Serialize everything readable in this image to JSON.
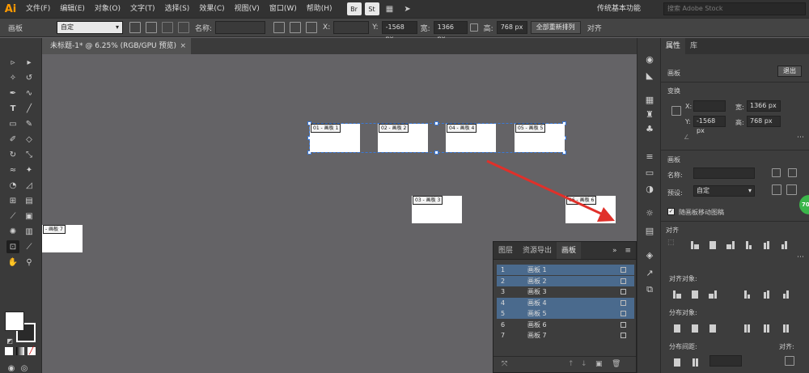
{
  "app": {
    "logo": "Ai",
    "workspace": "传统基本功能"
  },
  "menu": [
    "文件(F)",
    "编辑(E)",
    "对象(O)",
    "文字(T)",
    "选择(S)",
    "效果(C)",
    "视图(V)",
    "窗口(W)",
    "帮助(H)"
  ],
  "menu_badges": [
    "Br",
    "St"
  ],
  "search": {
    "placeholder": "搜索 Adobe Stock"
  },
  "control": {
    "panel_label": "画板",
    "preset": "自定",
    "name_label": "名称:",
    "x_label": "X:",
    "y_label": "Y:",
    "y_value": "-1568 px",
    "w_label": "宽:",
    "w_value": "1366 px",
    "h_label": "高:",
    "h_value": "768 px",
    "rearrange_button": "全部重新排列",
    "align_label": "对齐"
  },
  "doc_tab": {
    "title": "未标题-1* @ 6.25% (RGB/GPU 预览)",
    "close": "×"
  },
  "artboards": {
    "a1": "01 - 画板 1",
    "a2": "02 - 画板 2",
    "a3": "03 - 画板 3",
    "a4": "04 - 画板 4",
    "a5": "05 - 画板 5",
    "a6": "06 - 画板 6",
    "a7": "- 画板 7"
  },
  "float_panel": {
    "tabs": [
      "图层",
      "资源导出",
      "画板"
    ],
    "rows": [
      {
        "num": "1",
        "name": "画板 1",
        "selected": true
      },
      {
        "num": "2",
        "name": "画板 2",
        "selected": true
      },
      {
        "num": "3",
        "name": "画板 3",
        "selected": false
      },
      {
        "num": "4",
        "name": "画板 4",
        "selected": true
      },
      {
        "num": "5",
        "name": "画板 5",
        "selected": true
      },
      {
        "num": "6",
        "name": "画板 6",
        "selected": false
      },
      {
        "num": "7",
        "name": "画板 7",
        "selected": false
      }
    ],
    "menu_glyph": "≡",
    "expand_glyph": "»"
  },
  "props": {
    "tabs": [
      "属性",
      "库"
    ],
    "section_artboard": "画板",
    "exit_button": "退出",
    "transform_label": "变换",
    "x_label": "X:",
    "y_label": "Y:",
    "y_value": "-1568 px",
    "w_label": "宽:",
    "w_value": "1366 px",
    "h_label": "高:",
    "h_value": "768 px",
    "artboard_section": "画板",
    "name_label": "名称:",
    "preset_label": "预设:",
    "preset_value": "自定",
    "move_with_artboard": "随画板移动图稿",
    "align_label": "对齐",
    "align_objects": "对齐对象:",
    "distribute_objects": "分布对象:",
    "distribute_spacing": "分布间距:",
    "align_to": "对齐:"
  },
  "badge": "70"
}
